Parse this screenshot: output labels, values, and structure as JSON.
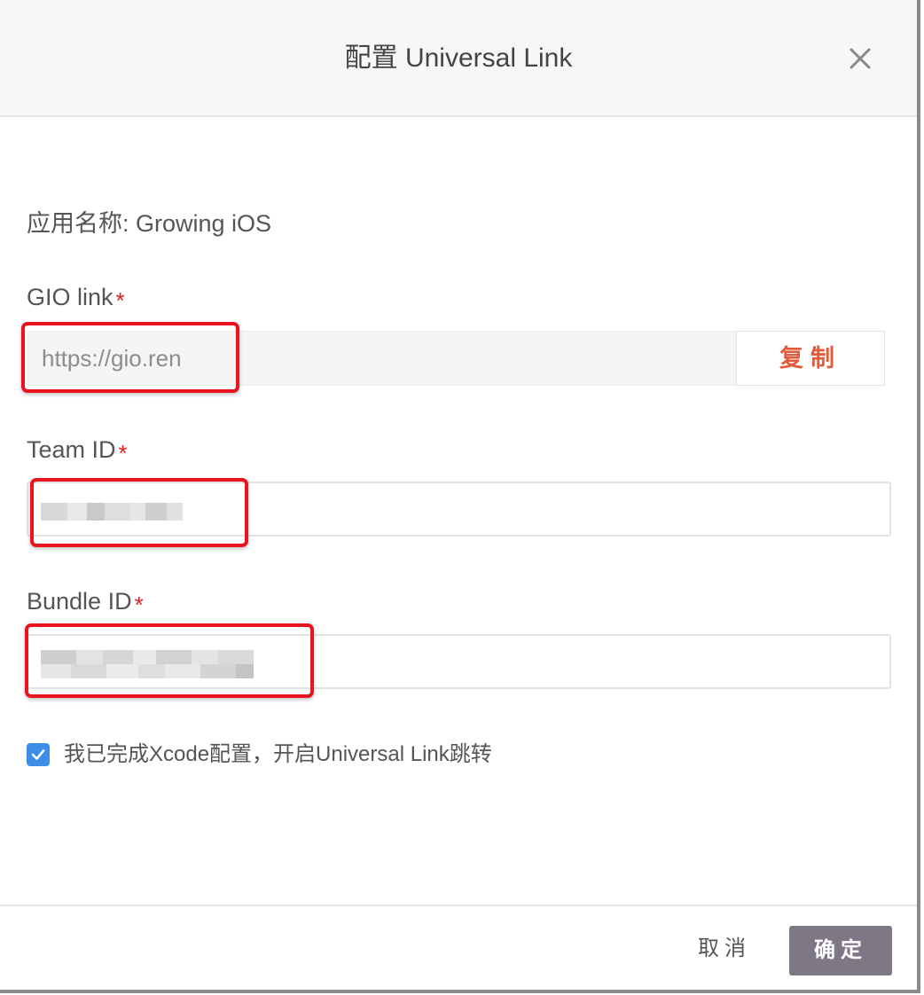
{
  "dialog": {
    "title": "配置 Universal Link",
    "close_icon": "close-icon"
  },
  "form": {
    "app_name_label": "应用名称: Growing iOS",
    "gio_link": {
      "label": "GIO link",
      "required_mark": "*",
      "value": "https://gio.ren",
      "copy_label": "复制"
    },
    "team_id": {
      "label": "Team ID",
      "required_mark": "*",
      "value": ""
    },
    "bundle_id": {
      "label": "Bundle ID",
      "required_mark": "*",
      "value": ""
    },
    "checkbox": {
      "checked": true,
      "label": "我已完成Xcode配置，开启Universal Link跳转"
    }
  },
  "footer": {
    "cancel_label": "取消",
    "ok_label": "确定"
  },
  "colors": {
    "accent_blue": "#3b8ee8",
    "copy_text": "#e35b3a",
    "required": "#e02020",
    "primary_button": "#7e7785",
    "highlight_red": "#e8141e"
  }
}
